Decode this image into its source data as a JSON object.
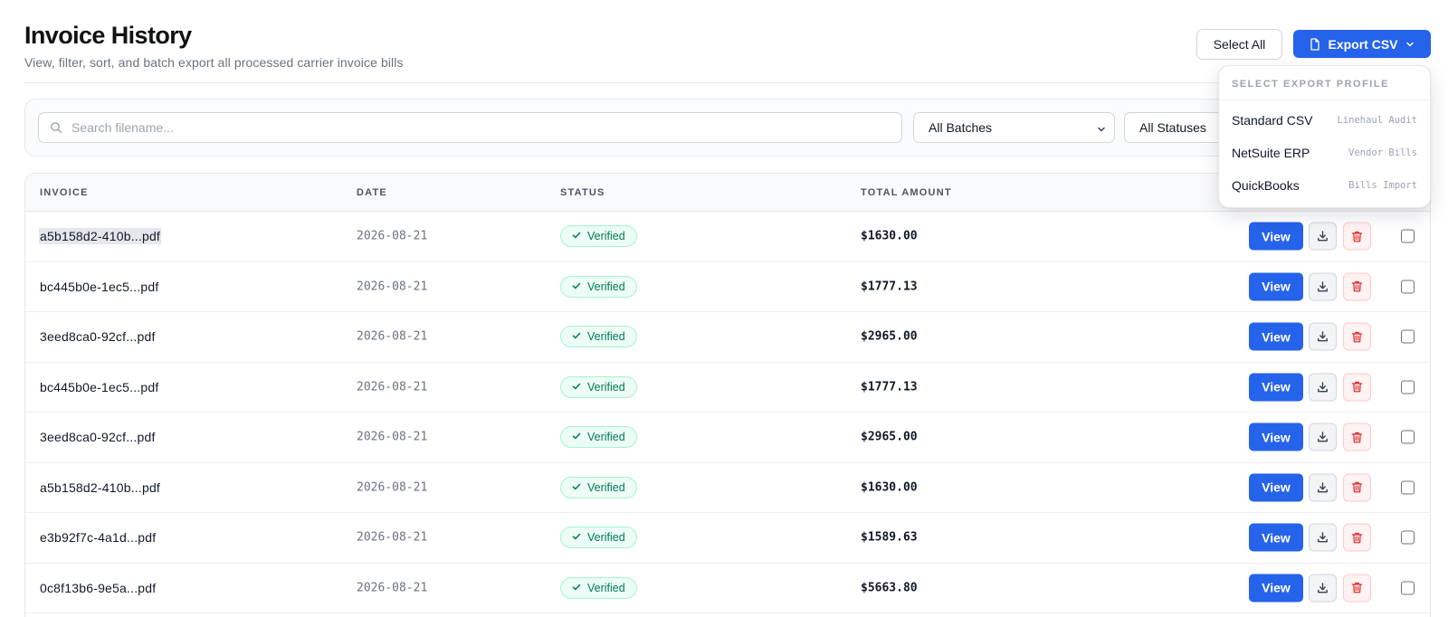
{
  "header": {
    "title": "Invoice History",
    "subtitle": "View, filter, sort, and batch export all processed carrier invoice bills",
    "select_all_label": "Select All",
    "export_label": "Export CSV"
  },
  "filters": {
    "search_placeholder": "Search filename...",
    "batch_select": "All Batches",
    "status_select": "All Statuses"
  },
  "table": {
    "columns": [
      "INVOICE",
      "DATE",
      "STATUS",
      "TOTAL AMOUNT"
    ],
    "view_label": "View",
    "rows": [
      {
        "invoice": "a5b158d2-410b...pdf",
        "date": "2026-08-21",
        "status": "Verified",
        "amount": "$1630.00",
        "selected": true
      },
      {
        "invoice": "bc445b0e-1ec5...pdf",
        "date": "2026-08-21",
        "status": "Verified",
        "amount": "$1777.13"
      },
      {
        "invoice": "3eed8ca0-92cf...pdf",
        "date": "2026-08-21",
        "status": "Verified",
        "amount": "$2965.00"
      },
      {
        "invoice": "bc445b0e-1ec5...pdf",
        "date": "2026-08-21",
        "status": "Verified",
        "amount": "$1777.13"
      },
      {
        "invoice": "3eed8ca0-92cf...pdf",
        "date": "2026-08-21",
        "status": "Verified",
        "amount": "$2965.00"
      },
      {
        "invoice": "a5b158d2-410b...pdf",
        "date": "2026-08-21",
        "status": "Verified",
        "amount": "$1630.00"
      },
      {
        "invoice": "e3b92f7c-4a1d...pdf",
        "date": "2026-08-21",
        "status": "Verified",
        "amount": "$1589.63"
      },
      {
        "invoice": "0c8f13b6-9e5a...pdf",
        "date": "2026-08-21",
        "status": "Verified",
        "amount": "$5663.80"
      }
    ]
  },
  "export_menu": {
    "heading": "SELECT EXPORT PROFILE",
    "items": [
      {
        "name": "Standard CSV",
        "tag": "Linehaul Audit"
      },
      {
        "name": "NetSuite ERP",
        "tag": "Vendor Bills"
      },
      {
        "name": "QuickBooks",
        "tag": "Bills Import"
      }
    ]
  },
  "colors": {
    "accent": "#2563eb",
    "verified_text": "#047857",
    "verified_bg": "#ecfdf5",
    "delete": "#dc2626"
  },
  "icons": {
    "search": "search-icon",
    "export": "file-icon",
    "chevron": "chevron-down-icon",
    "download": "download-icon",
    "delete": "trash-icon",
    "check": "check-icon"
  }
}
